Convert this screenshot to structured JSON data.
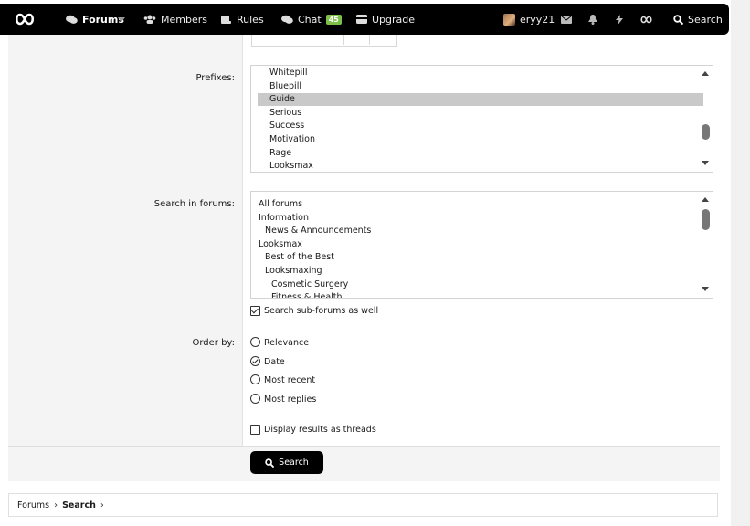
{
  "nav": {
    "forums": "Forums",
    "members": "Members",
    "rules": "Rules",
    "chat": "Chat",
    "chat_badge": "45",
    "upgrade": "Upgrade",
    "username": "eryy21",
    "search": "Search"
  },
  "form": {
    "prefixes_label": "Prefixes:",
    "prefixes": [
      "Whitepill",
      "Bluepill",
      "Guide",
      "Serious",
      "Success",
      "Motivation",
      "Rage",
      "Looksmax"
    ],
    "prefixes_selected": "Guide",
    "forums_label": "Search in forums:",
    "forums": [
      {
        "label": "All forums",
        "indent": 0
      },
      {
        "label": "Information",
        "indent": 0
      },
      {
        "label": "News & Announcements",
        "indent": 1
      },
      {
        "label": "Looksmax",
        "indent": 0
      },
      {
        "label": "Best of the Best",
        "indent": 1
      },
      {
        "label": "Looksmaxing",
        "indent": 1
      },
      {
        "label": "Cosmetic Surgery",
        "indent": 2
      },
      {
        "label": "Fitness & Health",
        "indent": 2
      }
    ],
    "subforums_label": "Search sub-forums as well",
    "subforums_checked": true,
    "order_label": "Order by:",
    "order_options": [
      "Relevance",
      "Date",
      "Most recent",
      "Most replies"
    ],
    "order_selected": "Date",
    "threads_label": "Display results as threads",
    "threads_checked": false,
    "submit_label": "Search"
  },
  "breadcrumb": {
    "items": [
      "Forums",
      "Search"
    ]
  },
  "icons": {
    "logo": "infinity-logo-icon",
    "forums": "chat-bubbles-icon",
    "members": "users-icon",
    "rules": "scroll-icon",
    "chat": "chat-icon",
    "upgrade": "card-icon",
    "mail": "envelope-icon",
    "bell": "bell-icon",
    "bolt": "bolt-icon",
    "search": "search-icon"
  }
}
